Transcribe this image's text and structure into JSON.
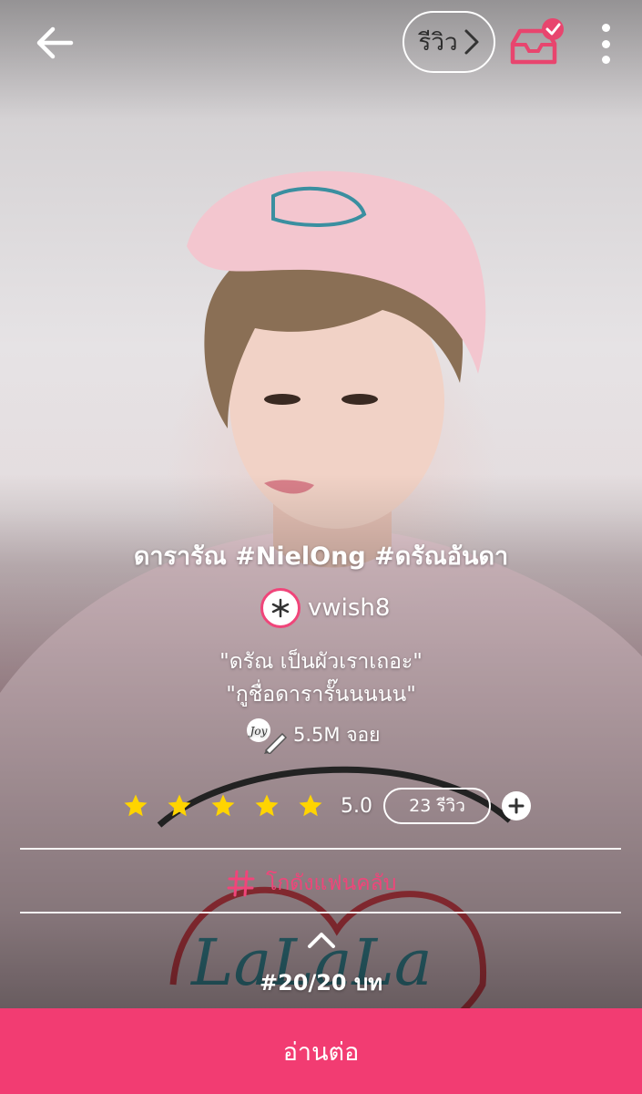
{
  "header": {
    "review_label": "รีวิว"
  },
  "story": {
    "title": "ดารารัณ #NielOng #ดรัณอันดา",
    "author": "vwish8",
    "tagline_line1": "\"ดรัณ เป็นผัวเราเถอะ\"",
    "tagline_line2": "\"กูชื่อดารารั๊นนนนน\"",
    "joy_count": "5.5M จอย",
    "joy_badge": "Joy",
    "rating": "5.0",
    "rating_stars": 5,
    "review_count": "23 รีวิว",
    "fanclub_label": "โกดังแฟนคลับ",
    "chapter_label": "#20/20 บท",
    "read_button": "อ่านต่อ"
  },
  "colors": {
    "accent": "#f23c72",
    "fanclub": "#f0457a",
    "star": "#ffd400",
    "inbox_icon": "#e8456e"
  },
  "icons": [
    "back-arrow-icon",
    "chevron-right-icon",
    "inbox-check-icon",
    "more-vertical-icon",
    "joy-pen-icon",
    "star-icon",
    "plus-icon",
    "hashtag-icon",
    "chevron-up-icon"
  ]
}
